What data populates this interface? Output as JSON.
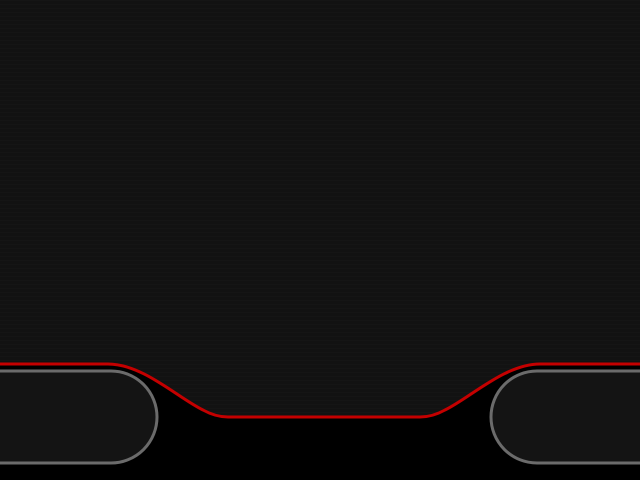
{
  "theme": {
    "background": "#000000",
    "panel": "#121212",
    "accent": "#c40000",
    "button_outline": "#6b6b6b",
    "button_fill": "#141414"
  },
  "left_button": {
    "label": "",
    "icon": "none"
  },
  "right_button": {
    "label": "",
    "icon": "none"
  }
}
